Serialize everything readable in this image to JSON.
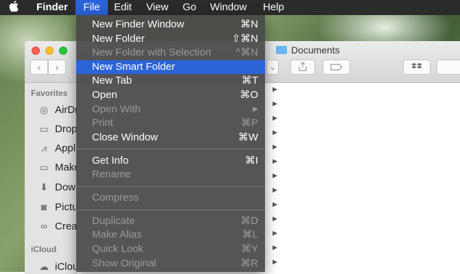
{
  "menubar": {
    "apple": "",
    "items": [
      "Finder",
      "File",
      "Edit",
      "View",
      "Go",
      "Window",
      "Help"
    ]
  },
  "window": {
    "title": "Documents",
    "sidebar": {
      "favorites_header": "Favorites",
      "favorites": [
        "AirDr",
        "Drop",
        "Appl",
        "Make",
        "Dow",
        "Pictu",
        "Crea"
      ],
      "icloud_header": "iCloud",
      "icloud": [
        "iClou"
      ]
    }
  },
  "file_menu": {
    "items": [
      {
        "label": "New Finder Window",
        "shortcut": "⌘N",
        "enabled": true
      },
      {
        "label": "New Folder",
        "shortcut": "⇧⌘N",
        "enabled": true
      },
      {
        "label": "New Folder with Selection",
        "shortcut": "^⌘N",
        "enabled": false
      },
      {
        "label": "New Smart Folder",
        "shortcut": "",
        "enabled": true,
        "highlighted": true
      },
      {
        "label": "New Tab",
        "shortcut": "⌘T",
        "enabled": true
      },
      {
        "label": "Open",
        "shortcut": "⌘O",
        "enabled": true
      },
      {
        "label": "Open With",
        "shortcut": "▶",
        "enabled": false
      },
      {
        "label": "Print",
        "shortcut": "⌘P",
        "enabled": false
      },
      {
        "label": "Close Window",
        "shortcut": "⌘W",
        "enabled": true
      },
      {
        "label": "Get Info",
        "shortcut": "⌘I",
        "enabled": true
      },
      {
        "label": "Rename",
        "shortcut": "",
        "enabled": false
      },
      {
        "label": "Compress",
        "shortcut": "",
        "enabled": false
      },
      {
        "label": "Duplicate",
        "shortcut": "⌘D",
        "enabled": false
      },
      {
        "label": "Make Alias",
        "shortcut": "⌘L",
        "enabled": false
      },
      {
        "label": "Quick Look",
        "shortcut": "⌘Y",
        "enabled": false
      },
      {
        "label": "Show Original",
        "shortcut": "⌘R",
        "enabled": false
      }
    ]
  },
  "colors": {
    "menu_highlight": "#2b63d8",
    "menubar_bg": "#2b2b2b"
  }
}
